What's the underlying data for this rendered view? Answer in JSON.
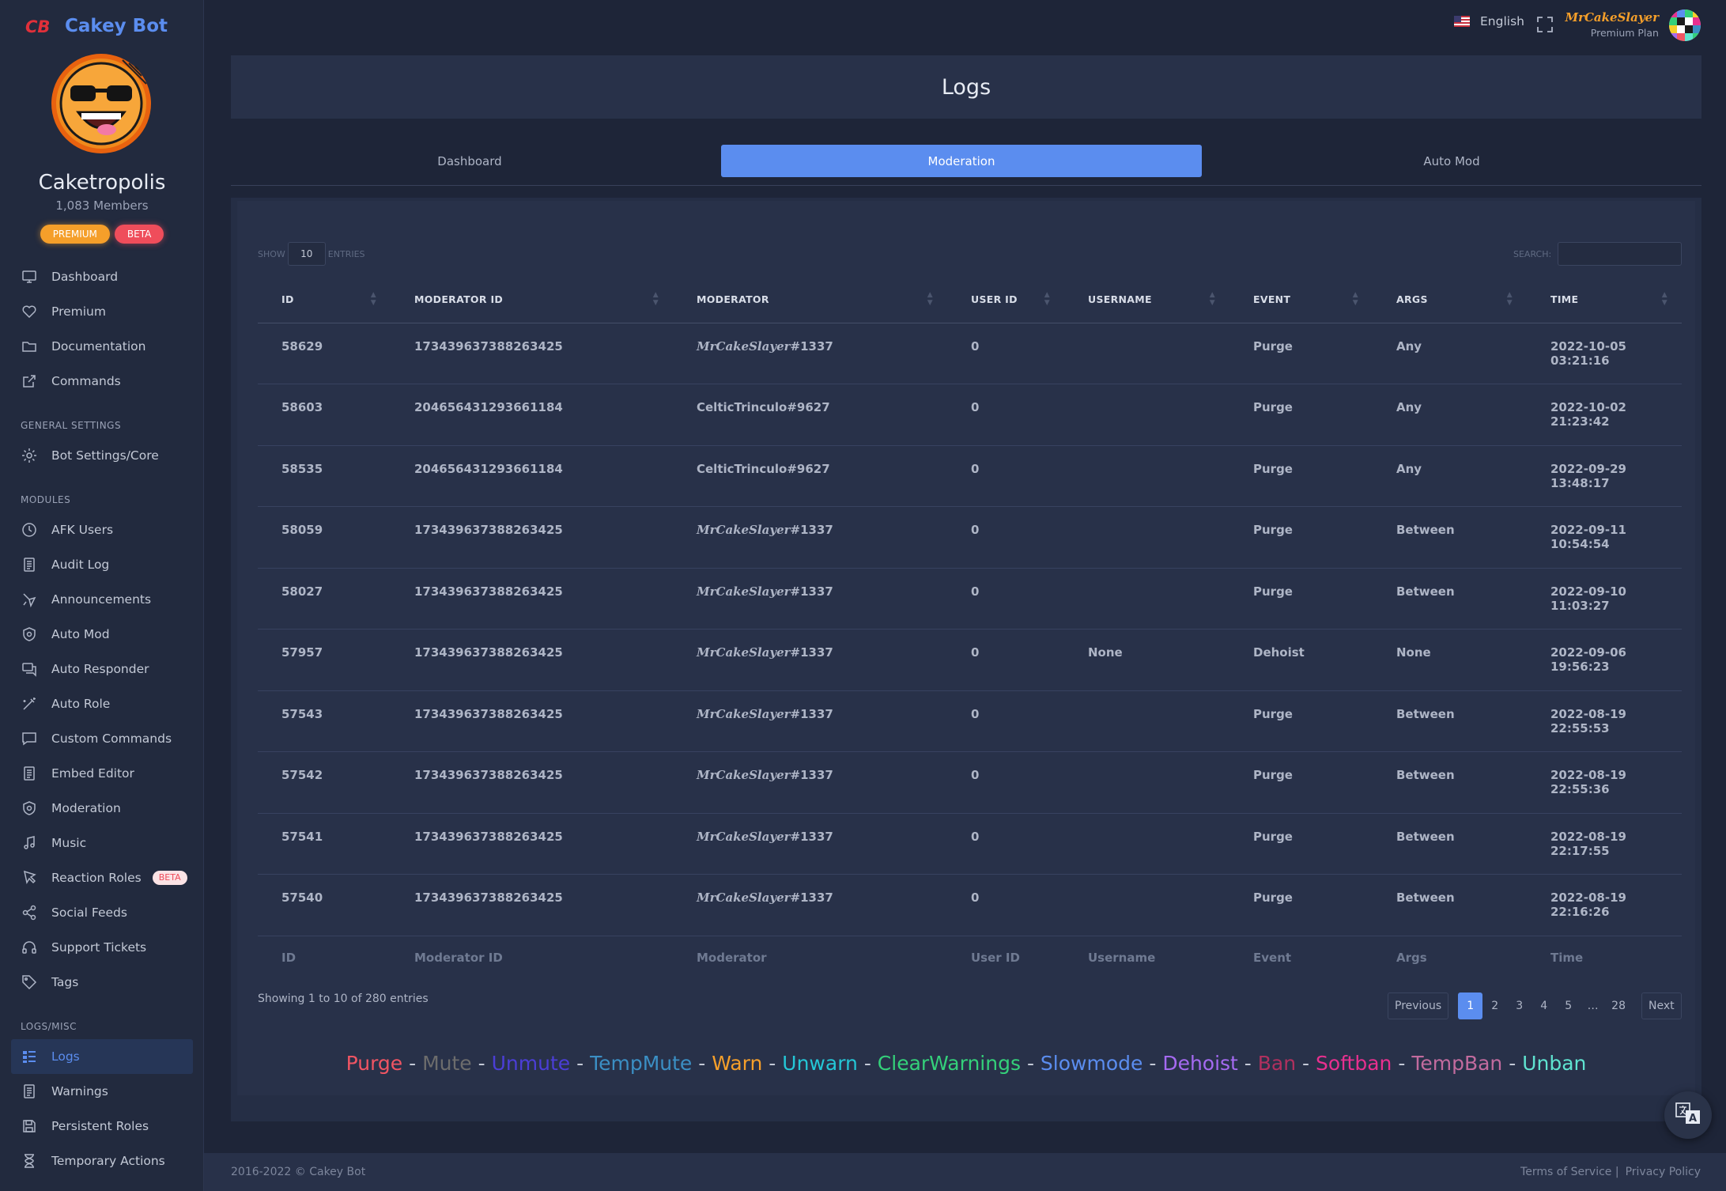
{
  "app": {
    "brand_name": "Cakey Bot",
    "server_name": "Caketropolis",
    "members": "1,083 Members",
    "badges": [
      "PREMIUM",
      "BETA"
    ]
  },
  "sidebar": {
    "top_items": [
      {
        "label": "Dashboard",
        "icon": "monitor-icon"
      },
      {
        "label": "Premium",
        "icon": "heart-icon"
      },
      {
        "label": "Documentation",
        "icon": "folder-icon"
      },
      {
        "label": "Commands",
        "icon": "external-link-icon"
      }
    ],
    "general_title": "GENERAL SETTINGS",
    "general_items": [
      {
        "label": "Bot Settings/Core",
        "icon": "gear-icon"
      }
    ],
    "modules_title": "MODULES",
    "module_items": [
      {
        "label": "AFK Users",
        "icon": "clock-icon"
      },
      {
        "label": "Audit Log",
        "icon": "file-text-icon"
      },
      {
        "label": "Announcements",
        "icon": "megaphone-icon"
      },
      {
        "label": "Auto Mod",
        "icon": "shield-icon"
      },
      {
        "label": "Auto Responder",
        "icon": "chat-icon"
      },
      {
        "label": "Auto Role",
        "icon": "magic-wand-icon"
      },
      {
        "label": "Custom Commands",
        "icon": "message-square-icon"
      },
      {
        "label": "Embed Editor",
        "icon": "document-icon"
      },
      {
        "label": "Moderation",
        "icon": "shield-icon"
      },
      {
        "label": "Music",
        "icon": "music-icon"
      },
      {
        "label": "Reaction Roles",
        "icon": "pointer-icon",
        "badge": "BETA"
      },
      {
        "label": "Social Feeds",
        "icon": "share-icon"
      },
      {
        "label": "Support Tickets",
        "icon": "headphones-icon"
      },
      {
        "label": "Tags",
        "icon": "tag-icon"
      }
    ],
    "logs_title": "LOGS/MISC",
    "logs_items": [
      {
        "label": "Logs",
        "icon": "grid-list-icon",
        "active": true
      },
      {
        "label": "Warnings",
        "icon": "file-text-icon"
      },
      {
        "label": "Persistent Roles",
        "icon": "save-icon"
      },
      {
        "label": "Temporary Actions",
        "icon": "hourglass-icon"
      }
    ]
  },
  "header": {
    "language": "English",
    "user_name": "MrCakeSlayer",
    "user_plan": "Premium Plan"
  },
  "page": {
    "title": "Logs",
    "tabs": [
      {
        "label": "Dashboard",
        "active": false
      },
      {
        "label": "Moderation",
        "active": true
      },
      {
        "label": "Auto Mod",
        "active": false
      }
    ]
  },
  "table": {
    "show_label": "SHOW",
    "entries_value": "10",
    "entries_label": "ENTRIES",
    "search_label": "SEARCH:",
    "columns": [
      "ID",
      "MODERATOR ID",
      "MODERATOR",
      "USER ID",
      "USERNAME",
      "EVENT",
      "ARGS",
      "TIME"
    ],
    "footer_columns": [
      "ID",
      "Moderator ID",
      "Moderator",
      "User ID",
      "Username",
      "Event",
      "Args",
      "Time"
    ],
    "rows": [
      {
        "id": "58629",
        "mod_id": "173439637388263425",
        "moderator": "MrCakeSlayer",
        "tag": "#1337",
        "fancy": true,
        "user_id": "0",
        "username": "",
        "event": "Purge",
        "args": "Any",
        "date": "2022-10-05",
        "time": "03:21:16"
      },
      {
        "id": "58603",
        "mod_id": "204656431293661184",
        "moderator": "CelticTrinculo",
        "tag": "#9627",
        "fancy": false,
        "user_id": "0",
        "username": "",
        "event": "Purge",
        "args": "Any",
        "date": "2022-10-02",
        "time": "21:23:42"
      },
      {
        "id": "58535",
        "mod_id": "204656431293661184",
        "moderator": "CelticTrinculo",
        "tag": "#9627",
        "fancy": false,
        "user_id": "0",
        "username": "",
        "event": "Purge",
        "args": "Any",
        "date": "2022-09-29",
        "time": "13:48:17"
      },
      {
        "id": "58059",
        "mod_id": "173439637388263425",
        "moderator": "MrCakeSlayer",
        "tag": "#1337",
        "fancy": true,
        "user_id": "0",
        "username": "",
        "event": "Purge",
        "args": "Between",
        "date": "2022-09-11",
        "time": "10:54:54"
      },
      {
        "id": "58027",
        "mod_id": "173439637388263425",
        "moderator": "MrCakeSlayer",
        "tag": "#1337",
        "fancy": true,
        "user_id": "0",
        "username": "",
        "event": "Purge",
        "args": "Between",
        "date": "2022-09-10",
        "time": "11:03:27"
      },
      {
        "id": "57957",
        "mod_id": "173439637388263425",
        "moderator": "MrCakeSlayer",
        "tag": "#1337",
        "fancy": true,
        "user_id": "0",
        "username": "None",
        "event": "Dehoist",
        "args": "None",
        "date": "2022-09-06",
        "time": "19:56:23"
      },
      {
        "id": "57543",
        "mod_id": "173439637388263425",
        "moderator": "MrCakeSlayer",
        "tag": "#1337",
        "fancy": true,
        "user_id": "0",
        "username": "",
        "event": "Purge",
        "args": "Between",
        "date": "2022-08-19",
        "time": "22:55:53"
      },
      {
        "id": "57542",
        "mod_id": "173439637388263425",
        "moderator": "MrCakeSlayer",
        "tag": "#1337",
        "fancy": true,
        "user_id": "0",
        "username": "",
        "event": "Purge",
        "args": "Between",
        "date": "2022-08-19",
        "time": "22:55:36"
      },
      {
        "id": "57541",
        "mod_id": "173439637388263425",
        "moderator": "MrCakeSlayer",
        "tag": "#1337",
        "fancy": true,
        "user_id": "0",
        "username": "",
        "event": "Purge",
        "args": "Between",
        "date": "2022-08-19",
        "time": "22:17:55"
      },
      {
        "id": "57540",
        "mod_id": "173439637388263425",
        "moderator": "MrCakeSlayer",
        "tag": "#1337",
        "fancy": true,
        "user_id": "0",
        "username": "",
        "event": "Purge",
        "args": "Between",
        "date": "2022-08-19",
        "time": "22:16:26"
      }
    ],
    "showing_text": "Showing 1 to 10 of 280 entries",
    "pagination": {
      "previous": "Previous",
      "pages": [
        "1",
        "2",
        "3",
        "4",
        "5",
        "…",
        "28"
      ],
      "current": "1",
      "next": "Next"
    }
  },
  "legend": [
    {
      "label": "Purge",
      "color": "#f05563"
    },
    {
      "label": "Mute",
      "color": "#6c6c6c"
    },
    {
      "label": "Unmute",
      "color": "#4b3ed6"
    },
    {
      "label": "TempMute",
      "color": "#3b8fc4"
    },
    {
      "label": "Warn",
      "color": "#f59f2a"
    },
    {
      "label": "Unwarn",
      "color": "#24c6d6"
    },
    {
      "label": "ClearWarnings",
      "color": "#34d07a"
    },
    {
      "label": "Slowmode",
      "color": "#5b8def"
    },
    {
      "label": "Dehoist",
      "color": "#a56af1"
    },
    {
      "label": "Ban",
      "color": "#b0305e"
    },
    {
      "label": "Softban",
      "color": "#e8308f"
    },
    {
      "label": "TempBan",
      "color": "#c26b9e"
    },
    {
      "label": "Unban",
      "color": "#5fe3d0"
    }
  ],
  "footer": {
    "copyright": "2016-2022 © Cakey Bot",
    "terms": "Terms of Service |",
    "privacy": "Privacy Policy"
  },
  "colors": {
    "accent": "#5b8def",
    "purge": "#f05563",
    "dehoist": "#a56af1",
    "premium": "#f59f2a",
    "beta": "#ef4d5b"
  }
}
